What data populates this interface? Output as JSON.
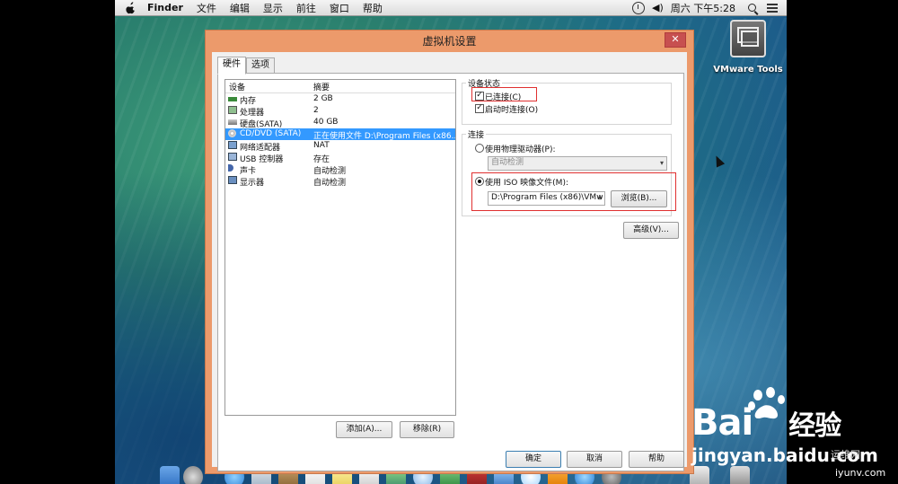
{
  "menubar": {
    "app": "Finder",
    "items": [
      "文件",
      "编辑",
      "显示",
      "前往",
      "窗口",
      "帮助"
    ],
    "clock": "周六 下午5:28"
  },
  "desktop": {
    "icon_label": "VMware Tools"
  },
  "dialog": {
    "title": "虚拟机设置",
    "close": "✕",
    "tabs": [
      "硬件",
      "选项"
    ],
    "list_headers": {
      "device": "设备",
      "summary": "摘要"
    },
    "devices": [
      {
        "name": "内存",
        "summary": "2 GB"
      },
      {
        "name": "处理器",
        "summary": "2"
      },
      {
        "name": "硬盘(SATA)",
        "summary": "40 GB"
      },
      {
        "name": "CD/DVD (SATA)",
        "summary": "正在使用文件 D:\\Program Files (x86..."
      },
      {
        "name": "网络适配器",
        "summary": "NAT"
      },
      {
        "name": "USB 控制器",
        "summary": "存在"
      },
      {
        "name": "声卡",
        "summary": "自动检测"
      },
      {
        "name": "显示器",
        "summary": "自动检测"
      }
    ],
    "add_button": "添加(A)...",
    "remove_button": "移除(R)",
    "device_status": {
      "title": "设备状态",
      "connected": "已连接(C)",
      "connect_on_power": "启动时连接(O)"
    },
    "connection": {
      "title": "连接",
      "physical": "使用物理驱动器(P):",
      "physical_value": "自动检测",
      "iso": "使用 ISO 映像文件(M):",
      "iso_path": "D:\\Program Files (x86)\\VMw",
      "browse": "浏览(B)..."
    },
    "advanced": "高级(V)...",
    "ok": "确定",
    "cancel": "取消",
    "help": "帮助"
  },
  "watermark": {
    "brand": "Bai",
    "brand2": "经验",
    "url": "jingyan.baidu.com",
    "site": "运维网",
    "site_url": "iyunv.com"
  },
  "colors": {
    "accent_selected": "#3399ff",
    "dialog_frame": "#ec9a6b",
    "highlight_box": "#e03030"
  }
}
